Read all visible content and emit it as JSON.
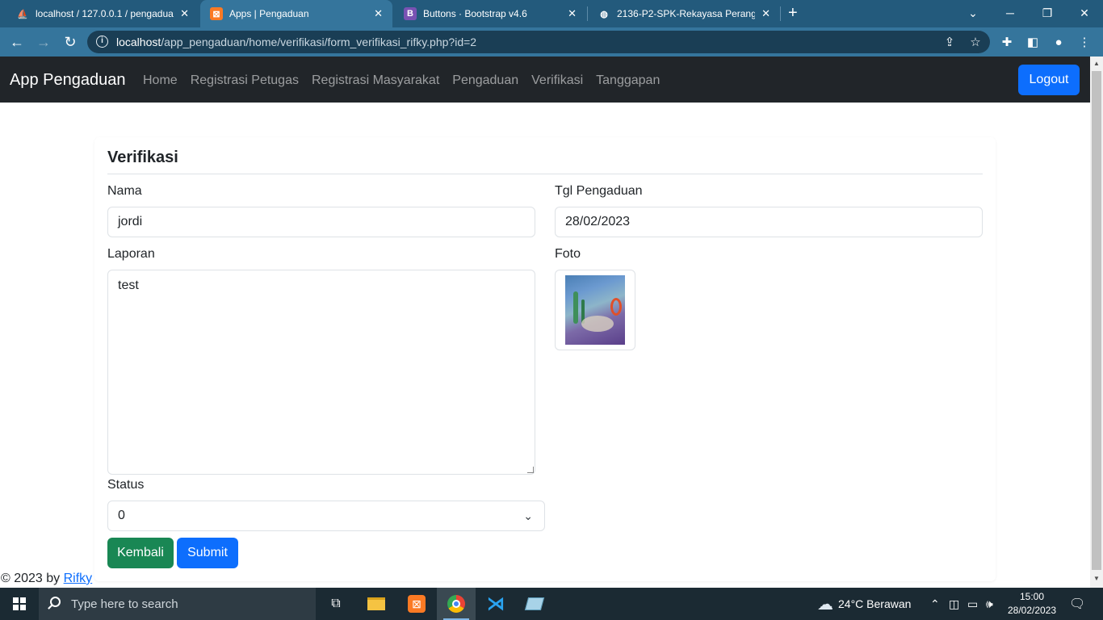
{
  "browser": {
    "tabs": [
      {
        "label": "localhost / 127.0.0.1 / pengaduan",
        "icon": "phpmyadmin-icon"
      },
      {
        "label": "Apps | Pengaduan",
        "icon": "xampp-icon"
      },
      {
        "label": "Buttons · Bootstrap v4.6",
        "icon": "bootstrap-icon"
      },
      {
        "label": "2136-P2-SPK-Rekayasa Perangkat",
        "icon": "globe-icon"
      }
    ],
    "url_host": "localhost",
    "url_path": "/app_pengaduan/home/verifikasi/form_verifikasi_rifky.php?id=2"
  },
  "navbar": {
    "brand": "App Pengaduan",
    "links": [
      "Home",
      "Registrasi Petugas",
      "Registrasi Masyarakat",
      "Pengaduan",
      "Verifikasi",
      "Tanggapan"
    ],
    "logout": "Logout"
  },
  "form": {
    "title": "Verifikasi",
    "nama_label": "Nama",
    "nama_value": "jordi",
    "tgl_label": "Tgl Pengaduan",
    "tgl_value": "28/02/2023",
    "laporan_label": "Laporan",
    "laporan_value": "test",
    "foto_label": "Foto",
    "status_label": "Status",
    "status_value": "0",
    "kembali": "Kembali",
    "submit": "Submit"
  },
  "footer": {
    "text": "© 2023 by",
    "link": "Rifky"
  },
  "taskbar": {
    "search_placeholder": "Type here to search",
    "weather": "24°C  Berawan",
    "time": "15:00",
    "date": "28/02/2023"
  }
}
